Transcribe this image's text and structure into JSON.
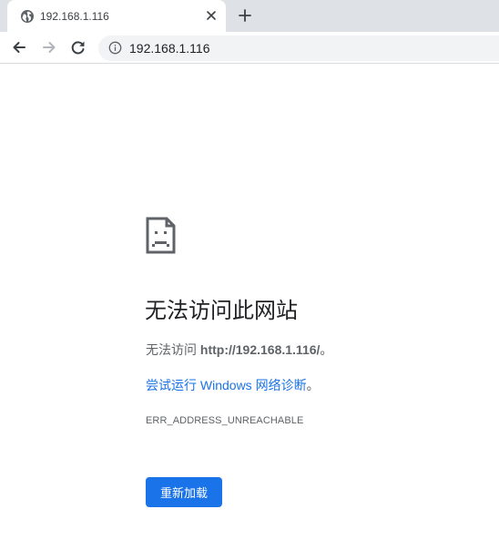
{
  "browser": {
    "tab": {
      "title": "192.168.1.116",
      "favicon": "globe-icon",
      "close_icon": "close-icon"
    },
    "new_tab_icon": "plus-icon",
    "toolbar": {
      "back_icon": "arrow-left-icon",
      "forward_icon": "arrow-right-icon",
      "reload_icon": "reload-icon",
      "site_info_icon": "info-icon",
      "url": "192.168.1.116"
    }
  },
  "error_page": {
    "icon": "sad-document-icon",
    "heading": "无法访问此网站",
    "description_prefix": "无法访问 ",
    "description_url": "http://192.168.1.116/",
    "description_suffix": "。",
    "suggestion_link": "尝试运行 Windows 网络诊断",
    "suggestion_suffix": "。",
    "error_code": "ERR_ADDRESS_UNREACHABLE",
    "reload_button": "重新加载"
  },
  "colors": {
    "accent": "#1a73e8",
    "tabstrip": "#dee1e6",
    "omnibox": "#f1f3f4",
    "secondary_text": "#5f6368"
  }
}
